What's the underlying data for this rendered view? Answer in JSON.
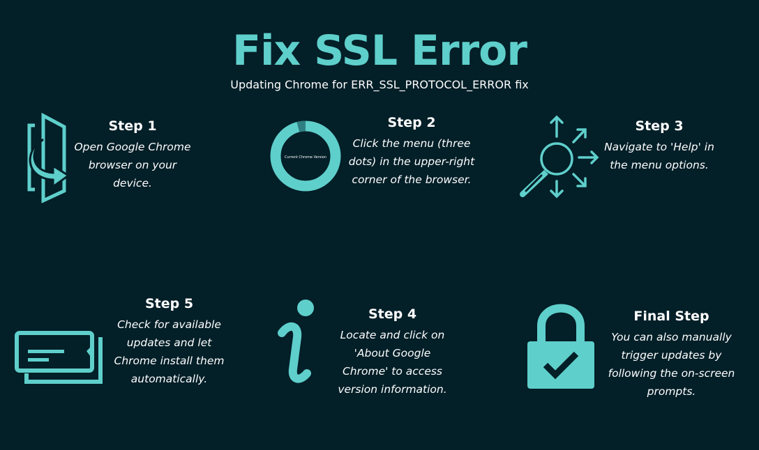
{
  "title": "Fix SSL Error",
  "subtitle": "Updating Chrome for ERR_SSL_PROTOCOL_ERROR fix",
  "colors": {
    "background": "#031f28",
    "accent": "#5fcfcb",
    "accent_dark": "#2f7f82"
  },
  "steps": [
    {
      "title": "Step 1",
      "text": "Open Google Chrome browser on your device.",
      "icon": "door-exit-icon"
    },
    {
      "title": "Step 2",
      "text": "Click the menu (three dots) in the upper-right corner of the browser.",
      "icon": "donut-chart-icon",
      "donut_label": "Current Chrome Version",
      "donut_fraction": 0.96
    },
    {
      "title": "Step 3",
      "text": "Navigate to 'Help' in the menu options.",
      "icon": "magnifier-arrows-icon"
    },
    {
      "title": "Step 5",
      "text": "Check for available updates and let Chrome install them automatically.",
      "icon": "ticket-icon"
    },
    {
      "title": "Step 4",
      "text": "Locate and click on 'About Google Chrome' to access version information.",
      "icon": "info-icon"
    },
    {
      "title": "Final Step",
      "text": "You can also manually trigger updates by following the on-screen prompts.",
      "icon": "padlock-check-icon"
    }
  ]
}
